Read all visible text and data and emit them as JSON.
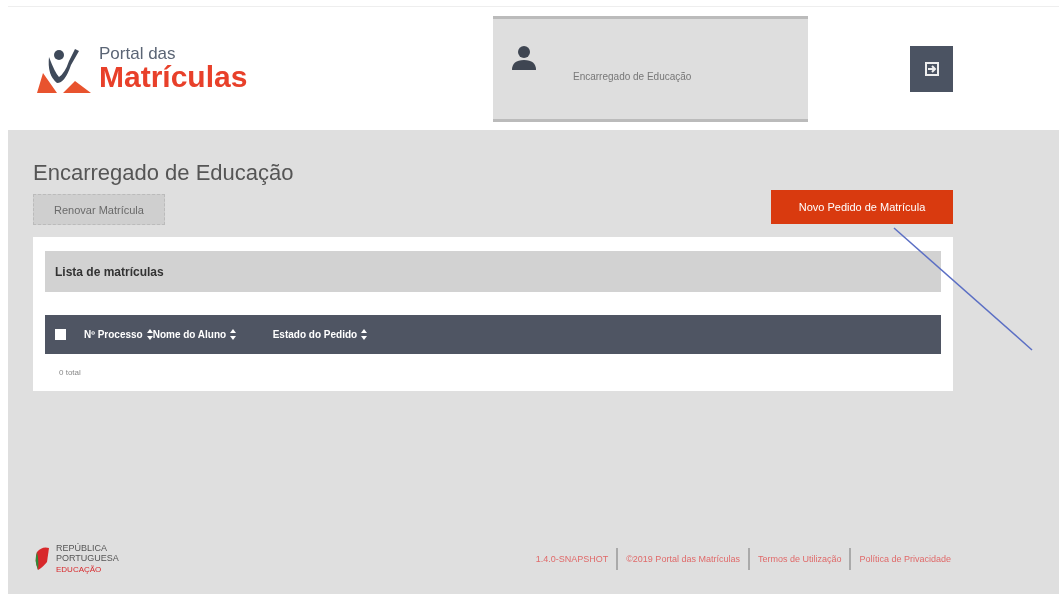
{
  "header": {
    "logo": {
      "top": "Portal das",
      "main": "Matrículas"
    },
    "user": {
      "role": "Encarregado de Educação"
    }
  },
  "page": {
    "title": "Encarregado de Educação",
    "buttons": [
      {
        "label": "Renovar Matrícula",
        "disabled": true,
        "kind": "secondary"
      },
      {
        "label": "Novo Pedido de Matrícula",
        "disabled": false,
        "kind": "primary"
      }
    ]
  },
  "panel": {
    "title": "Lista de matrículas",
    "select_all": {
      "checked": false
    },
    "columns": [
      "Nº Processo",
      "Nome do Aluno",
      "Estado do Pedido"
    ],
    "total": "0 total"
  },
  "footer": {
    "brand": [
      "REPÚBLICA",
      "PORTUGUESA",
      "EDUCAÇÃO"
    ],
    "links": [
      "1.4.0-SNAPSHOT",
      "©2019 Portal das Matrículas",
      "Termos de Utilização",
      "Política de Privacidade"
    ]
  }
}
